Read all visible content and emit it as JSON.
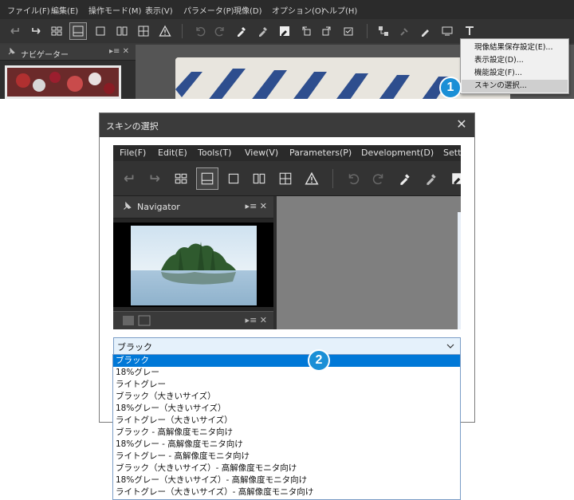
{
  "app": {
    "menu": [
      "ファイル(F)",
      "編集(E)",
      "操作モード(M)",
      "表示(V)",
      "パラメータ(P)",
      "現像(D)",
      "オプション(O)",
      "ヘルプ(H)"
    ],
    "navigator_title": "ナビゲーター",
    "navigator_controls": "▸≡ ✕",
    "dropdown": {
      "items": [
        "現像結果保存設定(E)...",
        "表示設定(D)...",
        "機能設定(F)...",
        "スキンの選択..."
      ],
      "highlighted_index": 3
    }
  },
  "callouts": {
    "one": "1",
    "two": "2"
  },
  "dialog": {
    "title": "スキンの選択",
    "close_glyph": "✕",
    "preview": {
      "menu": [
        "File(F)",
        "Edit(E)",
        "Tools(T)",
        "View(V)",
        "Parameters(P)",
        "Development(D)",
        "Setti"
      ],
      "navigator_title": "Navigator",
      "navigator_controls": "▸≡ ✕"
    },
    "skin_select": {
      "value": "ブラック",
      "options": [
        "ブラック",
        "18%グレー",
        "ライトグレー",
        "ブラック（大きいサイズ）",
        "18%グレー（大きいサイズ）",
        "ライトグレー（大きいサイズ）",
        "ブラック - 高解像度モニタ向け",
        "18%グレー - 高解像度モニタ向け",
        "ライトグレー - 高解像度モニタ向け",
        "ブラック（大きいサイズ）- 高解像度モニタ向け",
        "18%グレー（大きいサイズ）- 高解像度モニタ向け",
        "ライトグレー（大きいサイズ）- 高解像度モニタ向け"
      ],
      "selected_index": 0
    }
  },
  "colors": {
    "accent": "#0078d7",
    "callout": "#1a8fd6",
    "dark_bg": "#2b2b2b"
  }
}
